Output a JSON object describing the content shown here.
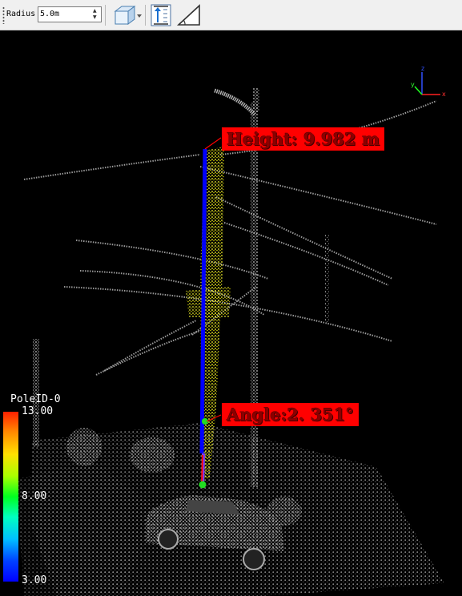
{
  "toolbar": {
    "radius_label": "Radius",
    "radius_value": "5.0m",
    "icons": [
      "cube-view-icon",
      "vertical-measure-icon",
      "angle-measure-icon"
    ]
  },
  "viewport": {
    "height_label": "Height: 9.982 m",
    "angle_label": "Angle:2. 351°",
    "axes": {
      "x": "x",
      "y": "y",
      "z": "z"
    },
    "scale": {
      "title": "PoleID-0",
      "max": "13.00",
      "mid": "8.00",
      "min": "3.00"
    },
    "colors": {
      "callout_bg": "#ff0000",
      "callout_text": "#8b0000",
      "pole_line": "#0000ff",
      "points_highlight": "#ffff00",
      "points_other": "#b4b4b4"
    }
  }
}
